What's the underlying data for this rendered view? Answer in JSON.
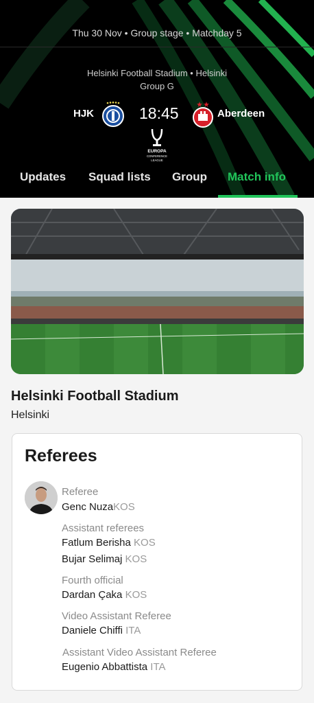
{
  "match": {
    "date_line": "Thu 30 Nov • Group stage • Matchday 5",
    "venue_line": "Helsinki Football Stadium • Helsinki",
    "group": "Group G",
    "home_team": "HJK",
    "away_team": "Aberdeen",
    "kickoff": "18:45",
    "competition_logo_text": [
      "EUROPA",
      "CONFERENCE",
      "LEAGUE"
    ]
  },
  "tabs": [
    {
      "label": "Updates",
      "active": false
    },
    {
      "label": "Squad lists",
      "active": false
    },
    {
      "label": "Group",
      "active": false
    },
    {
      "label": "Match info",
      "active": true
    }
  ],
  "stadium": {
    "name": "Helsinki Football Stadium",
    "city": "Helsinki"
  },
  "referees": {
    "title": "Referees",
    "referee_role": "Referee",
    "referee": {
      "name": "Genc Nuza",
      "nat": "KOS"
    },
    "assistants_role": "Assistant referees",
    "assistants": [
      {
        "name": "Fatlum Berisha",
        "nat": "KOS"
      },
      {
        "name": "Bujar Selimaj",
        "nat": "KOS"
      }
    ],
    "fourth_role": "Fourth official",
    "fourth": {
      "name": "Dardan Çaka",
      "nat": "KOS"
    },
    "var_role": "Video Assistant Referee",
    "var": {
      "name": "Daniele Chiffi",
      "nat": "ITA"
    },
    "avar_role": "Assistant Video Assistant Referee",
    "avar": {
      "name": "Eugenio Abbattista",
      "nat": "ITA"
    }
  },
  "colors": {
    "accent_green": "#21c45a",
    "header_bg": "#000000"
  }
}
